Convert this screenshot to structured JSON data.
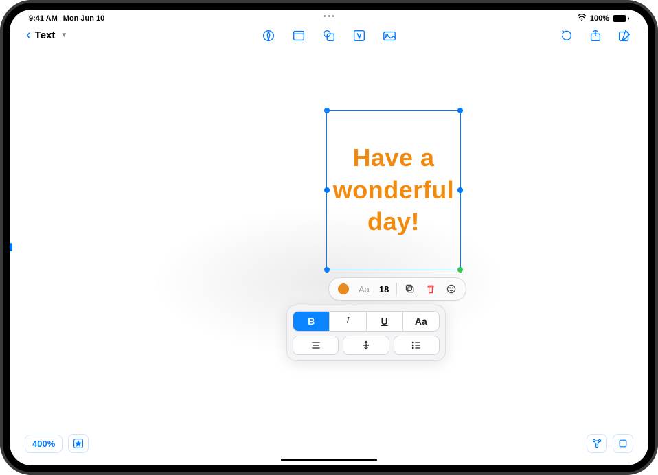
{
  "status": {
    "time": "9:41 AM",
    "date": "Mon Jun 10",
    "battery_pct": "100%"
  },
  "toolbar": {
    "back_label": "Text"
  },
  "textbox": {
    "content": "Have a wonderful day!",
    "color": "#f18b10"
  },
  "context": {
    "font_sample": "Aa",
    "font_size": "18"
  },
  "format": {
    "bold": "B",
    "italic": "I",
    "underline": "U",
    "case": "Aa"
  },
  "zoom": {
    "level": "400%"
  }
}
